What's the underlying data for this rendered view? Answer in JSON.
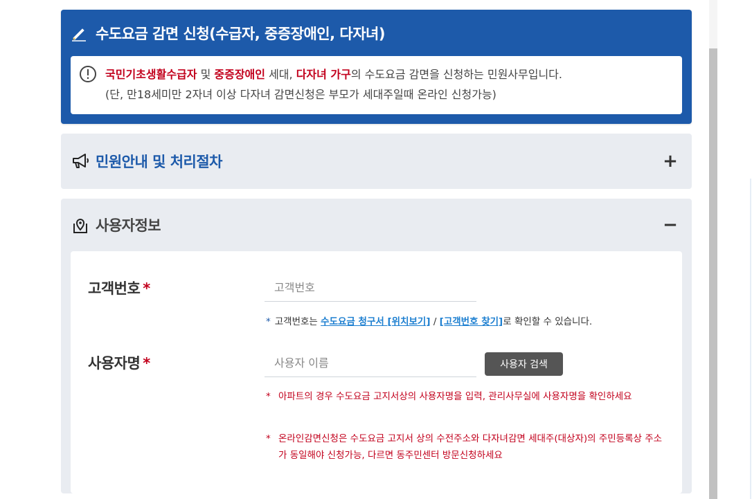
{
  "hero": {
    "title": "수도요금 감면 신청(수급자, 중증장애인, 다자녀)",
    "info": {
      "part1": "국민기초생활수급자",
      "part2": " 및 ",
      "part3": "중증장애인",
      "part4": " 세대, ",
      "part5": "다자녀 가구",
      "part6": "의 수도요금 감면을 신청하는 민원사무입니다.",
      "line2": "(단, 만18세미만 2자녀 이상 다자녀 감면신청은 부모가 세대주일때 온라인 신청가능)"
    }
  },
  "guide_section": {
    "title": "민원안내 및 처리절차",
    "toggle": "+"
  },
  "user_section": {
    "title": "사용자정보",
    "toggle": "−",
    "customer_no": {
      "label": "고객번호",
      "required_mark": "*",
      "placeholder": "고객번호",
      "note_star": "*",
      "note_prefix": "고객번호는 ",
      "link1": "수도요금 청구서 [위치보기]",
      "sep": " / ",
      "link2": "[고객번호 찾기]",
      "note_suffix": "로 확인할 수 있습니다."
    },
    "user_name": {
      "label": "사용자명",
      "required_mark": "*",
      "placeholder": "사용자 이름",
      "search_button": "사용자 검색",
      "note1_star": "*",
      "note1": "아파트의 경우 수도요금 고지서상의 사용자명을 입력, 관리사무실에 사용자명을 확인하세요",
      "note2_star": "*",
      "note2": "온라인감면신청은 수도요금 고지서 상의 수전주소와 다자녀감면 세대주(대상자)의 주민등록상 주소가 동일해야 신청가능, 다르면 동주민센터 방문신청하세요"
    }
  },
  "colors": {
    "brand_blue": "#1d5aaa",
    "accent_red": "#c2001c",
    "link_blue": "#1d7fd0"
  }
}
